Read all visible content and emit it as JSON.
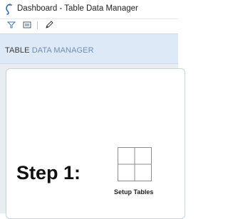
{
  "window": {
    "title": "Dashboard - Table Data Manager",
    "icon": "app-logo-icon"
  },
  "toolbar": {
    "icons": [
      "filter-icon",
      "image-icon",
      "pencil-icon"
    ]
  },
  "header": {
    "title_part1": "TABLE ",
    "title_part2": "DATA MANAGER"
  },
  "main": {
    "step_label": "Step 1:",
    "action_label": "Setup Tables",
    "action_icon": "table-grid-icon"
  },
  "colors": {
    "header_band": "#dde9f6",
    "header_accent_text": "#6f8fb5",
    "content_background": "#e8edf2"
  }
}
